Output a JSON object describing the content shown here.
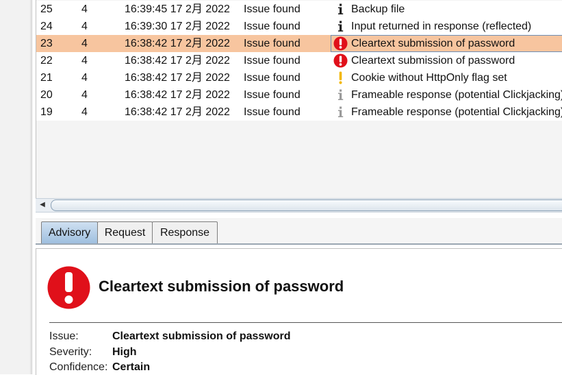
{
  "issues_table": {
    "rows": [
      {
        "num": "25",
        "host": "4",
        "time": "16:39:45 17 2月 2022",
        "action": "Issue found",
        "severity": "info",
        "issue": "Backup file"
      },
      {
        "num": "24",
        "host": "4",
        "time": "16:39:30 17 2月 2022",
        "action": "Issue found",
        "severity": "info",
        "issue": "Input returned in response (reflected)"
      },
      {
        "num": "23",
        "host": "4",
        "time": "16:38:42 17 2月 2022",
        "action": "Issue found",
        "severity": "high",
        "issue": "Cleartext submission of password"
      },
      {
        "num": "22",
        "host": "4",
        "time": "16:38:42 17 2月 2022",
        "action": "Issue found",
        "severity": "high",
        "issue": "Cleartext submission of password"
      },
      {
        "num": "21",
        "host": "4",
        "time": "16:38:42 17 2月 2022",
        "action": "Issue found",
        "severity": "low",
        "issue": "Cookie without HttpOnly flag set"
      },
      {
        "num": "20",
        "host": "4",
        "time": "16:38:42 17 2月 2022",
        "action": "Issue found",
        "severity": "info-light",
        "issue": "Frameable response (potential Clickjacking)"
      },
      {
        "num": "19",
        "host": "4",
        "time": "16:38:42 17 2月 2022",
        "action": "Issue found",
        "severity": "info-light",
        "issue": "Frameable response (potential Clickjacking)"
      }
    ],
    "selected_index": 2
  },
  "tabs": {
    "advisory": "Advisory",
    "request": "Request",
    "response": "Response",
    "active": "advisory"
  },
  "advisory": {
    "icon": "high-severity-alert-icon",
    "title": "Cleartext submission of password",
    "issue_key": "Issue:",
    "issue_value": "Cleartext submission of password",
    "severity_key": "Severity:",
    "severity_value": "High",
    "confidence_key": "Confidence:",
    "confidence_value": "Certain"
  },
  "colors": {
    "selected_row": "#f7c59f",
    "high_severity": "#e0101a",
    "low_severity": "#f2b705",
    "active_tab": "#9fbfdf"
  }
}
